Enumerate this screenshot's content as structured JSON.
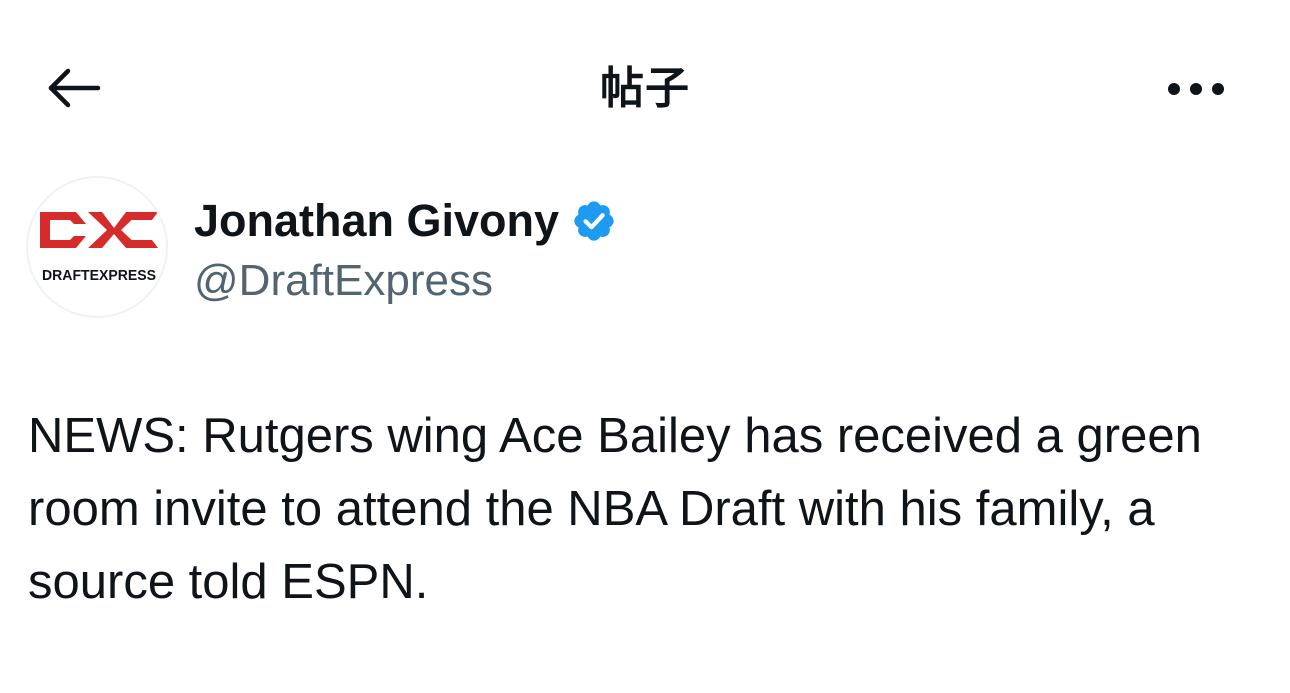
{
  "header": {
    "title": "帖子",
    "back_icon": "back-arrow-icon",
    "more_icon": "more-options-icon"
  },
  "author": {
    "display_name": "Jonathan Givony",
    "handle": "@DraftExpress",
    "verified": true,
    "verified_color": "#1d9bf0",
    "avatar_logo_text": "DRAFTEXPRESS",
    "avatar_logo_color": "#d62b2b"
  },
  "tweet": {
    "text": "NEWS: Rutgers wing Ace Bailey has received a green room invite to attend the NBA Draft with his family, a source told ESPN."
  },
  "colors": {
    "text_primary": "#0f1419",
    "text_secondary": "#536471",
    "background": "#ffffff"
  }
}
